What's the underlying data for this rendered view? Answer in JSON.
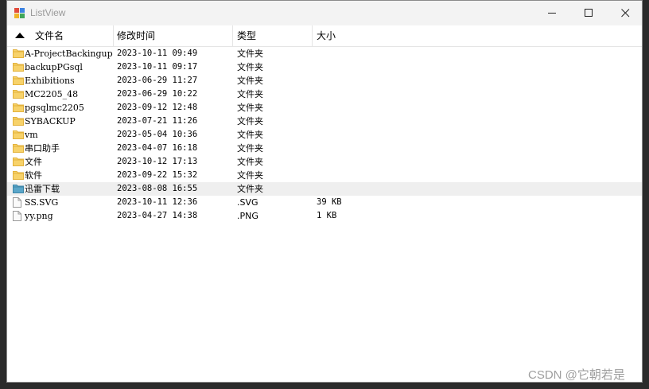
{
  "window": {
    "title": "ListView"
  },
  "columns": [
    {
      "label": "文件名"
    },
    {
      "label": "修改时间"
    },
    {
      "label": "类型"
    },
    {
      "label": "大小"
    }
  ],
  "rows": [
    {
      "name": "A-ProjectBackingup",
      "modified": "2023-10-11 09:49",
      "type": "文件夹",
      "size": "",
      "icon": "folder-icon"
    },
    {
      "name": "backupPGsql",
      "modified": "2023-10-11 09:17",
      "type": "文件夹",
      "size": "",
      "icon": "folder-icon"
    },
    {
      "name": "Exhibitions",
      "modified": "2023-06-29 11:27",
      "type": "文件夹",
      "size": "",
      "icon": "folder-icon"
    },
    {
      "name": "MC2205_48",
      "modified": "2023-06-29 10:22",
      "type": "文件夹",
      "size": "",
      "icon": "folder-icon"
    },
    {
      "name": "pgsqlmc2205",
      "modified": "2023-09-12 12:48",
      "type": "文件夹",
      "size": "",
      "icon": "folder-icon"
    },
    {
      "name": "SYBACKUP",
      "modified": "2023-07-21 11:26",
      "type": "文件夹",
      "size": "",
      "icon": "folder-icon"
    },
    {
      "name": "vm",
      "modified": "2023-05-04 10:36",
      "type": "文件夹",
      "size": "",
      "icon": "folder-icon"
    },
    {
      "name": "串口助手",
      "modified": "2023-04-07 16:18",
      "type": "文件夹",
      "size": "",
      "icon": "folder-icon"
    },
    {
      "name": "文件",
      "modified": "2023-10-12 17:13",
      "type": "文件夹",
      "size": "",
      "icon": "folder-icon"
    },
    {
      "name": "软件",
      "modified": "2023-09-22 15:32",
      "type": "文件夹",
      "size": "",
      "icon": "folder-icon"
    },
    {
      "name": "迅雷下载",
      "modified": "2023-08-08 16:55",
      "type": "文件夹",
      "size": "",
      "icon": "special-folder-icon"
    },
    {
      "name": "SS.SVG",
      "modified": "2023-10-11 12:36",
      "type": ".SVG",
      "size": "39 KB",
      "icon": "file-icon"
    },
    {
      "name": "yy.png",
      "modified": "2023-04-27 14:38",
      "type": ".PNG",
      "size": "1 KB",
      "icon": "file-icon"
    }
  ],
  "selected_row": 10,
  "sort": {
    "column": 0,
    "direction": "ascending"
  },
  "watermark": "CSDN @它朝若是",
  "colors": {
    "folder": "#f7d26a",
    "folder_dark": "#e3b23c",
    "selection": "#efefef",
    "special_folder": "#5aa6c9"
  }
}
